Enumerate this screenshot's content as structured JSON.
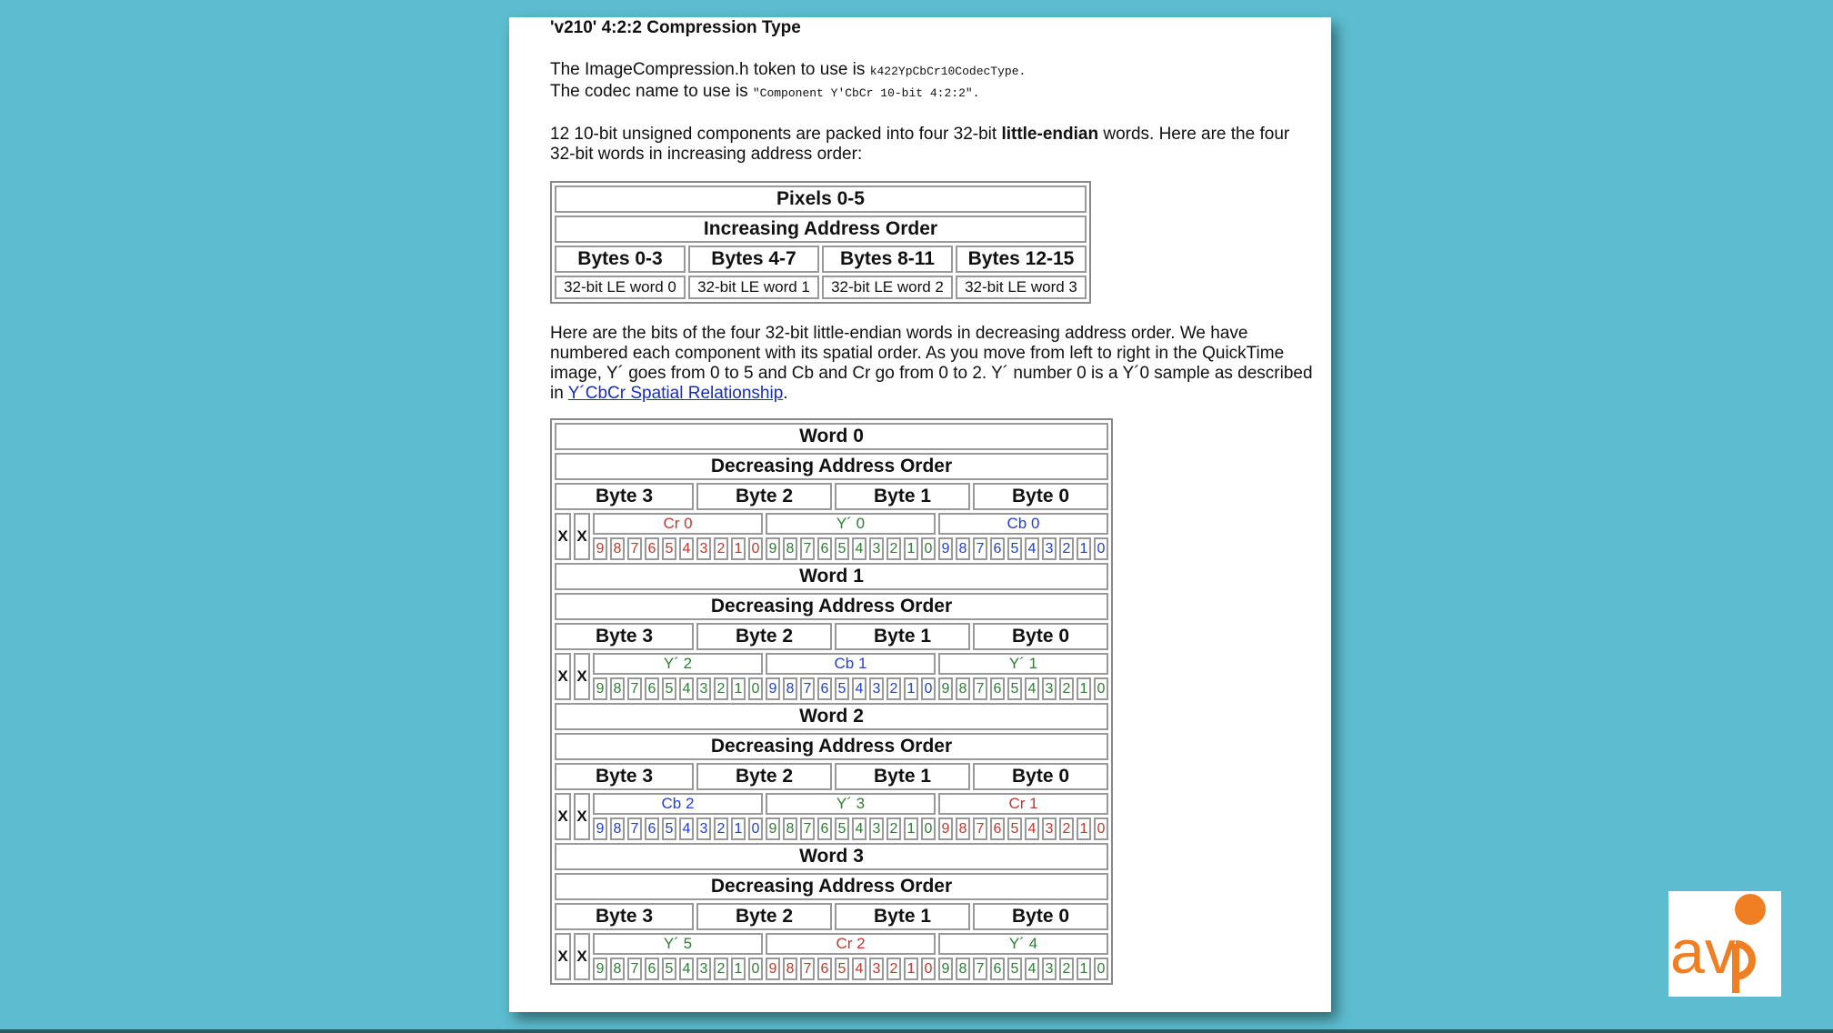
{
  "doc": {
    "title": "'v210' 4:2:2 Compression Type",
    "token_line_prefix": "The ImageCompression.h token to use is ",
    "token_value": "k422YpCbCr10CodecType.",
    "codec_line_prefix": "The codec name to use is ",
    "codec_value": "\"Component Y'CbCr 10-bit 4:2:2\".",
    "para1_a": "12 10-bit unsigned components are packed into four 32-bit ",
    "para1_bold": "little-endian",
    "para1_b": " words. Here are the four 32-bit words in increasing address order:",
    "para2": "Here are the bits of the four 32-bit little-endian words in decreasing address order. We have numbered each component with its spatial order. As you move from left to right in the QuickTime image, Y´ goes from 0 to 5 and Cb and Cr go from 0 to 2. Y´ number 0 is a Y´0 sample as described in ",
    "para2_link": "Y´CbCr Spatial Relationship",
    "para2_end": "."
  },
  "pixels_table": {
    "title": "Pixels 0-5",
    "subtitle": "Increasing Address Order",
    "byte_headers": [
      "Bytes 0-3",
      "Bytes 4-7",
      "Bytes 8-11",
      "Bytes 12-15"
    ],
    "words": [
      "32-bit LE word 0",
      "32-bit LE word 1",
      "32-bit LE word 2",
      "32-bit LE word 3"
    ]
  },
  "word_tables": [
    {
      "title": "Word 0",
      "subtitle": "Decreasing Address Order",
      "bytes": [
        "Byte 3",
        "Byte 2",
        "Byte 1",
        "Byte 0"
      ],
      "x": [
        "X",
        "X"
      ],
      "components": [
        {
          "label": "Cr 0",
          "color": "#c0392b"
        },
        {
          "label": "Y´ 0",
          "color": "#2e7d32"
        },
        {
          "label": "Cb 0",
          "color": "#1f3fd0"
        }
      ],
      "bits": [
        "9",
        "8",
        "7",
        "6",
        "5",
        "4",
        "3",
        "2",
        "1",
        "0"
      ]
    },
    {
      "title": "Word 1",
      "subtitle": "Decreasing Address Order",
      "bytes": [
        "Byte 3",
        "Byte 2",
        "Byte 1",
        "Byte 0"
      ],
      "x": [
        "X",
        "X"
      ],
      "components": [
        {
          "label": "Y´ 2",
          "color": "#2e7d32"
        },
        {
          "label": "Cb 1",
          "color": "#1f3fd0"
        },
        {
          "label": "Y´ 1",
          "color": "#2e7d32"
        }
      ],
      "bits": [
        "9",
        "8",
        "7",
        "6",
        "5",
        "4",
        "3",
        "2",
        "1",
        "0"
      ]
    },
    {
      "title": "Word 2",
      "subtitle": "Decreasing Address Order",
      "bytes": [
        "Byte 3",
        "Byte 2",
        "Byte 1",
        "Byte 0"
      ],
      "x": [
        "X",
        "X"
      ],
      "components": [
        {
          "label": "Cb 2",
          "color": "#1f3fd0"
        },
        {
          "label": "Y´ 3",
          "color": "#2e7d32"
        },
        {
          "label": "Cr 1",
          "color": "#c0392b"
        }
      ],
      "bits": [
        "9",
        "8",
        "7",
        "6",
        "5",
        "4",
        "3",
        "2",
        "1",
        "0"
      ]
    },
    {
      "title": "Word 3",
      "subtitle": "Decreasing Address Order",
      "bytes": [
        "Byte 3",
        "Byte 2",
        "Byte 1",
        "Byte 0"
      ],
      "x": [
        "X",
        "X"
      ],
      "components": [
        {
          "label": "Y´ 5",
          "color": "#2e7d32"
        },
        {
          "label": "Cr 2",
          "color": "#c0392b"
        },
        {
          "label": "Y´ 4",
          "color": "#2e7d32"
        }
      ],
      "bits": [
        "9",
        "8",
        "7",
        "6",
        "5",
        "4",
        "3",
        "2",
        "1",
        "0"
      ]
    }
  ],
  "logo": {
    "text": "avp",
    "color": "#f07e22"
  }
}
